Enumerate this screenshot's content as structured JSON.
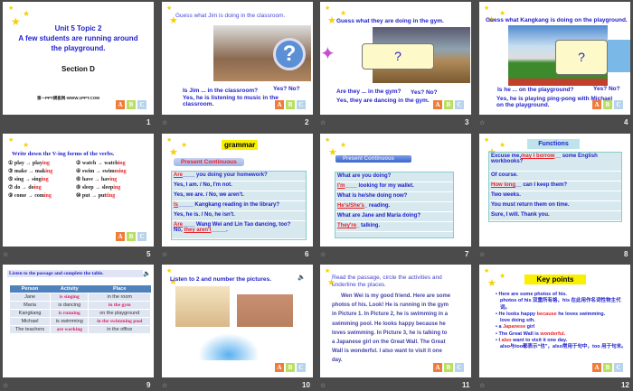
{
  "slides": [
    {
      "number": "1",
      "title1": "Unit 5 Topic 2",
      "title2": "A few students are running around",
      "title3": "the playground.",
      "section": "Section D",
      "watermark": "第一PPT模板网-WWW.1PPT.COM"
    },
    {
      "number": "2",
      "heading": "Guess what Jim is doing in the classroom.",
      "q": "Is Jim ... in the classroom?",
      "yn": "Yes? No?",
      "a1": "Yes, he is listening to music in the",
      "a2": "classroom."
    },
    {
      "number": "3",
      "heading": "Guess what they are doing in the gym.",
      "mark": "?",
      "q": "Are they ... in the gym?",
      "yn": "Yes? No?",
      "a1": "Yes, they are dancing in the gym."
    },
    {
      "number": "4",
      "heading": "Guess what Kangkang is doing on the playground.",
      "mark": "?",
      "q": "Is he ... on the playground?",
      "yn": "Yes? No?",
      "a1": "Yes, he is playing ping-pong with Michael",
      "a2": "on the playground."
    },
    {
      "number": "5",
      "heading": "Write down the V-ing forms of the verbs.",
      "verbs": [
        {
          "n": "①",
          "base": "play",
          "stem": "play",
          "end": "ing"
        },
        {
          "n": "②",
          "base": "watch",
          "stem": "watch",
          "end": "ing"
        },
        {
          "n": "③",
          "base": "make",
          "stem": "mak",
          "end": "ing"
        },
        {
          "n": "④",
          "base": "swim",
          "stem": "swim",
          "end": "ming"
        },
        {
          "n": "⑤",
          "base": "sing",
          "stem": "sing",
          "end": "ing"
        },
        {
          "n": "⑥",
          "base": "have",
          "stem": "hav",
          "end": "ing"
        },
        {
          "n": "⑦",
          "base": "do",
          "stem": "do",
          "end": "ing"
        },
        {
          "n": "⑧",
          "base": "sleep",
          "stem": "sleep",
          "end": "ing"
        },
        {
          "n": "⑨",
          "base": "come",
          "stem": "com",
          "end": "ing"
        },
        {
          "n": "⑩",
          "base": "put",
          "stem": "put",
          "end": "ting"
        }
      ]
    },
    {
      "number": "6",
      "heading": "grammar",
      "sub": "Present Continuous",
      "r1a": "Are",
      "r1b": "you doing your homework?",
      "r2": "Yes, I am. / No, I'm not.",
      "r3": "Yes, we are. / No, we aren't.",
      "r4a": "Is",
      "r4b": "Kangkang reading in the library?",
      "r5": "Yes, he is. / No, he isn't.",
      "r6a": "Are",
      "r6b": "Wang Wei and Lin Tao dancing, too?",
      "r7a": "No,",
      "r7b": "they aren't"
    },
    {
      "number": "7",
      "sub": "Present Continuous",
      "r1": "What are you doing?",
      "r2a": "I'm",
      "r2b": "looking for my wallet.",
      "r3": "What is he/she doing now?",
      "r4a": "He's/She's",
      "r4b": "reading.",
      "r5": "What are Jane and Maria doing?",
      "r6a": "They're",
      "r6b": "talking."
    },
    {
      "number": "8",
      "heading": "Functions",
      "r1a": "Excuse me,",
      "r1b": "may I borrow",
      "r1c": "some English",
      "r1d": "workbooks?",
      "r2": "Of course.",
      "r3a": "How long",
      "r3b": "can I keep them?",
      "r4": "Two weeks.",
      "r5": "You must return them on time.",
      "r6": "Sure, I will. Thank you."
    },
    {
      "number": "9",
      "heading": "Listen to the passage and complete the table.",
      "headers": [
        "Person",
        "Activity",
        "Place"
      ],
      "rows": [
        [
          "Jane",
          "is singing",
          "in the room"
        ],
        [
          "Maria",
          "is dancing",
          "in the gym"
        ],
        [
          "Kangkang",
          "is running",
          "on the playground"
        ],
        [
          "Michael",
          "is swimming",
          "in the swimming pool"
        ],
        [
          "The teachers",
          "are working",
          "in the office"
        ]
      ]
    },
    {
      "number": "10",
      "heading": "Listen to 2 and number the pictures."
    },
    {
      "number": "11",
      "instr1": "Read the passage, circle the activities and",
      "instr2": "underline the places.",
      "lines": [
        "Wen Wei is my good friend. Here are some",
        "photos of his. Look! He is running in the gym",
        "in Picture 1. In Picture 2, he is swimming in a",
        "swimming pool. He looks happy because he",
        "loves swimming. In Picture 3, he is talking to",
        "a Japanese girl on the Great Wall. The Great",
        "Wall is wonderful. I also want to visit it one",
        "day."
      ]
    },
    {
      "number": "12",
      "heading": "Key points",
      "p1": "Here are some photos of his.",
      "p1n": "photos of his 双重所有格，his 在此用作名词性物主代词。",
      "p2a": "He looks happy ",
      "p2b": "because",
      "p2c": " he loves swimming.",
      "p2n": "love doing sth.",
      "p3a": "a ",
      "p3b": "Japanese",
      "p3c": " girl",
      "p4a": "The Great Wall is ",
      "p4b": "wonderful.",
      "p5a": "I ",
      "p5b": "also",
      "p5c": " want to visit it one day.",
      "p5n": "also与too都表示“也”，also常用于句中，too 用于句末。"
    }
  ],
  "abc": [
    "A",
    "B",
    "C"
  ],
  "colors": {
    "text_blue": "#2222cc",
    "accent_red": "#e8232a",
    "star": "#f5d000",
    "background": "#4b4b4b"
  }
}
